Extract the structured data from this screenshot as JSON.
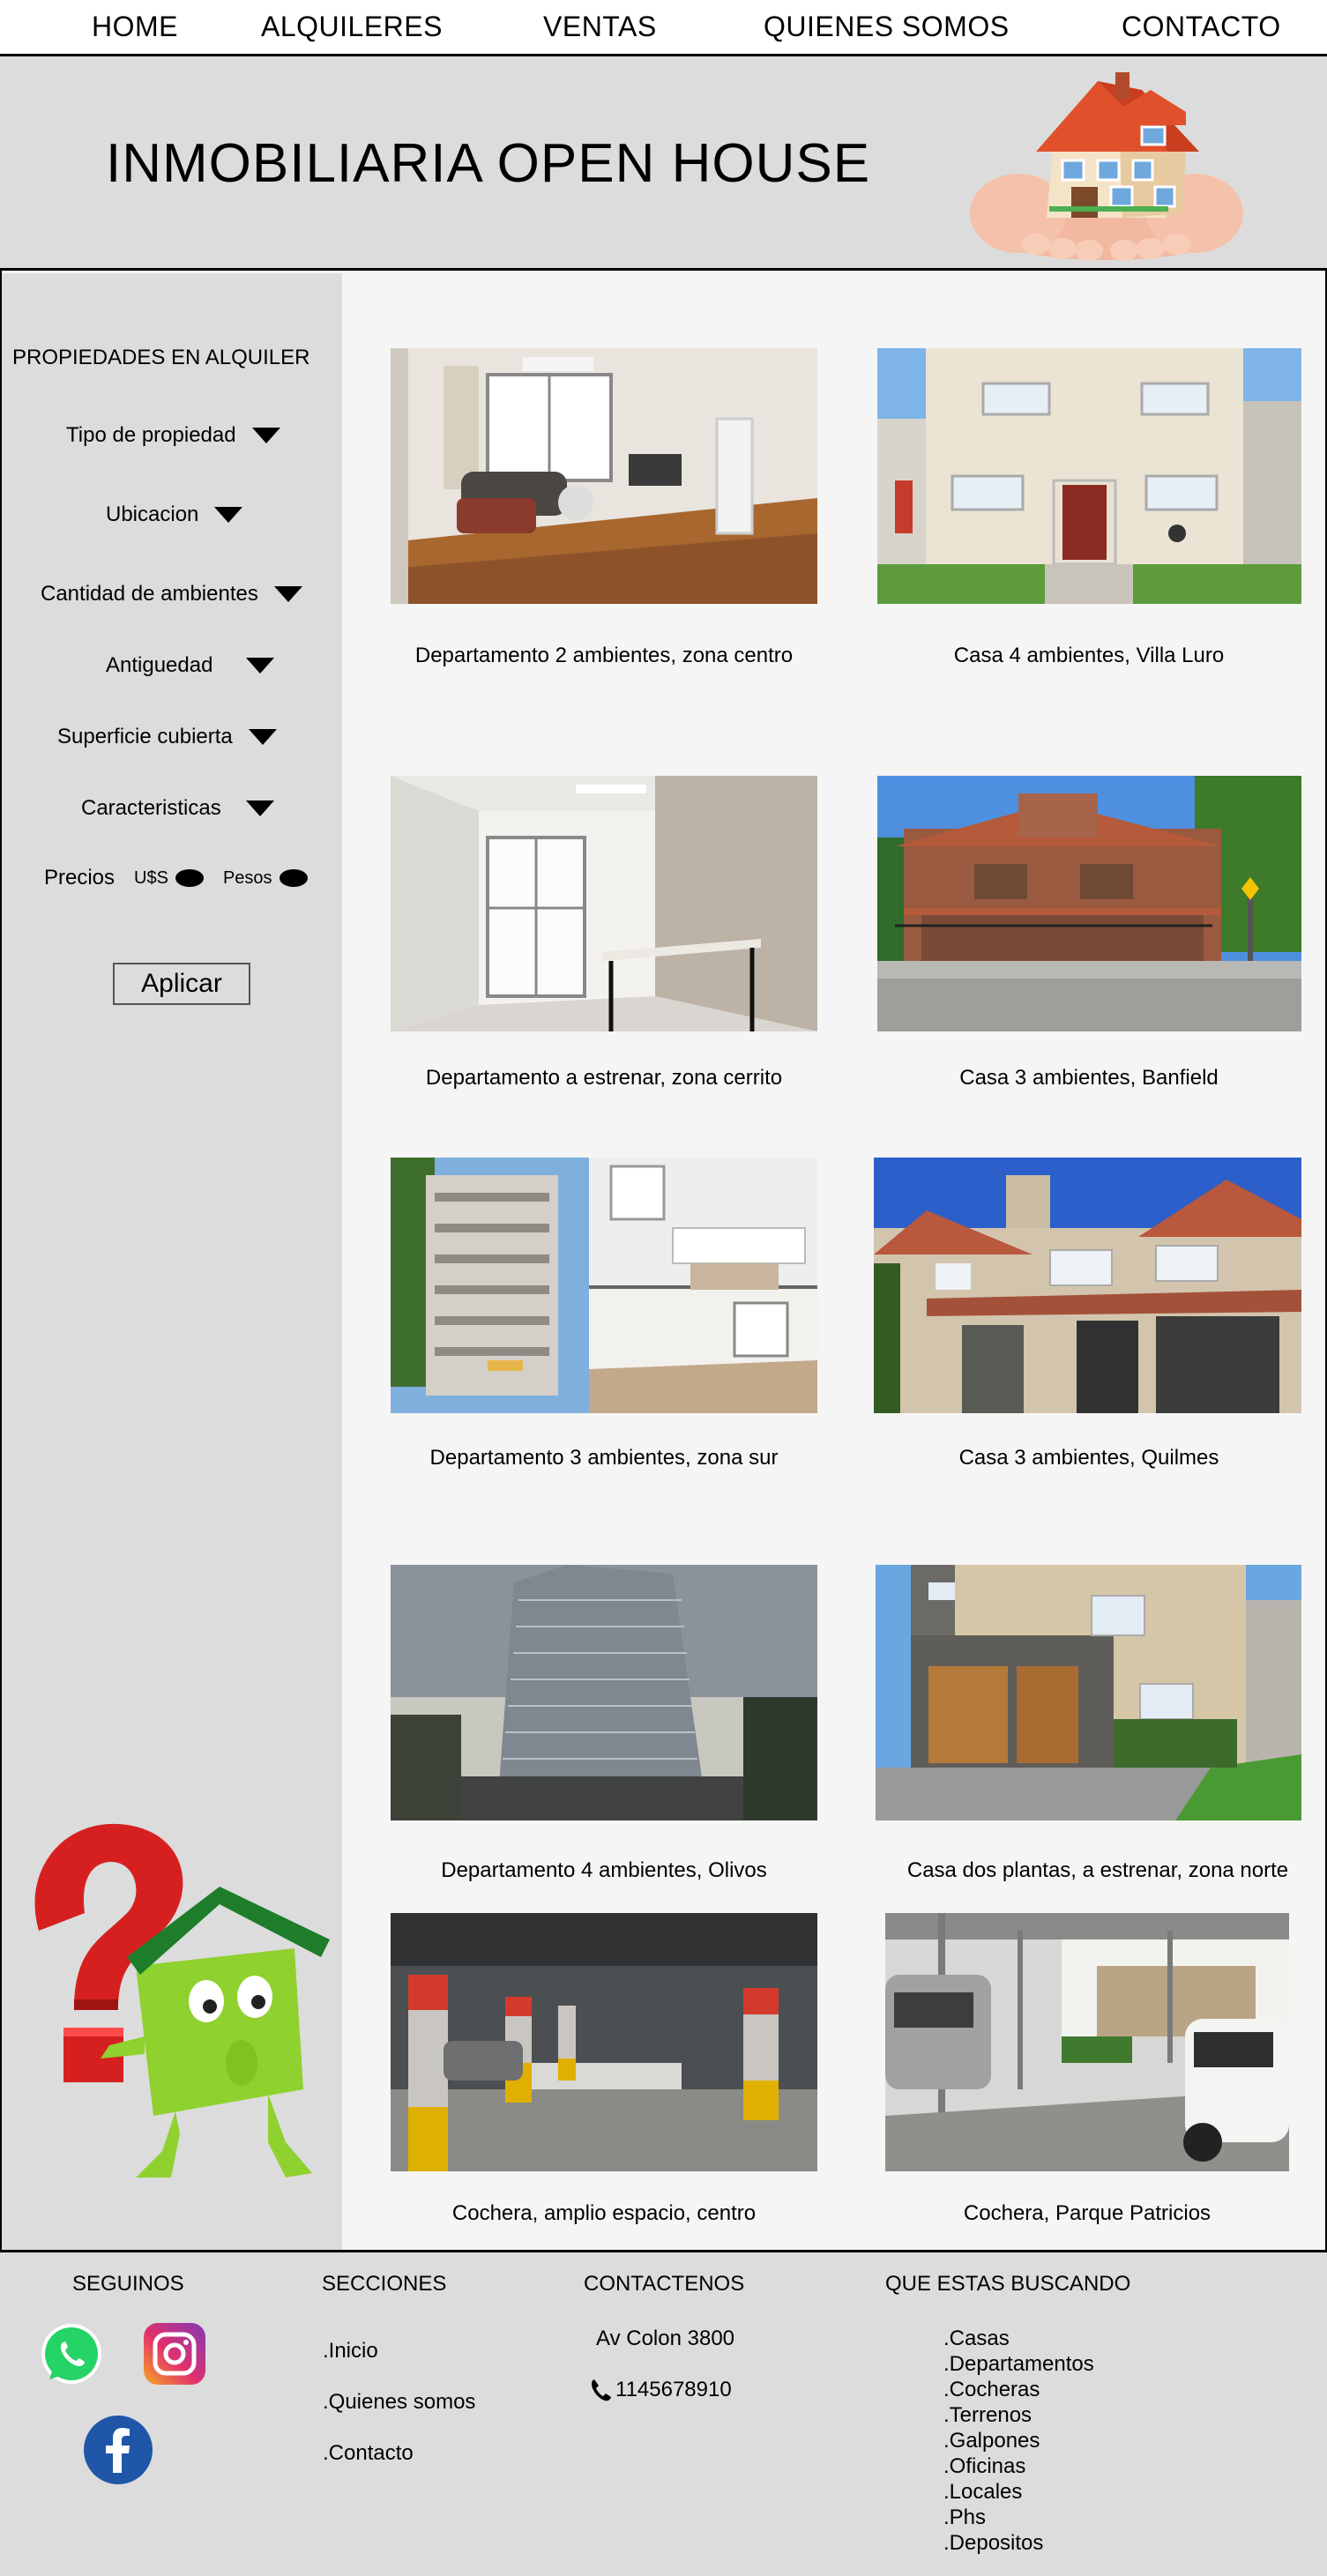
{
  "nav": {
    "home": "HOME",
    "alquileres": "ALQUILERES",
    "ventas": "VENTAS",
    "quienes": "QUIENES SOMOS",
    "contacto": "CONTACTO"
  },
  "header": {
    "title": "INMOBILIARIA OPEN HOUSE"
  },
  "sidebar": {
    "title": "PROPIEDADES EN ALQUILER",
    "filters": [
      "Tipo de propiedad",
      "Ubicacion",
      "Cantidad de ambientes",
      "Antiguedad",
      "Superficie cubierta",
      "Caracteristicas"
    ],
    "prices_label": "Precios",
    "currency_usd": "U$S",
    "currency_pesos": "Pesos",
    "apply_button": "Aplicar"
  },
  "listings": [
    {
      "caption": "Departamento 2 ambientes, zona centro",
      "icon": "apartment-living-room-photo"
    },
    {
      "caption": "Casa 4 ambientes, Villa Luro",
      "icon": "house-facade-photo"
    },
    {
      "caption": "Departamento a estrenar, zona cerrito",
      "icon": "empty-apartment-photo"
    },
    {
      "caption": "Casa 3 ambientes, Banfield",
      "icon": "brick-house-photo"
    },
    {
      "caption": "Departamento 3 ambientes, zona sur",
      "icon": "apartment-building-photo"
    },
    {
      "caption": "Casa 3 ambientes, Quilmes",
      "icon": "two-story-house-photo"
    },
    {
      "caption": "Departamento 4 ambientes, Olivos",
      "icon": "tower-photo"
    },
    {
      "caption": "Casa dos plantas, a estrenar, zona norte",
      "icon": "modern-house-photo"
    },
    {
      "caption": "Cochera, amplio espacio, centro",
      "icon": "parking-garage-photo"
    },
    {
      "caption": "Cochera, Parque Patricios",
      "icon": "carport-photo"
    }
  ],
  "footer": {
    "seguinos": "SEGUINOS",
    "secciones": "SECCIONES",
    "contactenos": "CONTACTENOS",
    "que_buscas": "QUE ESTAS BUSCANDO",
    "section_links": [
      ".Inicio",
      ".Quienes somos",
      ".Contacto"
    ],
    "address": "Av Colon 3800",
    "phone": "1145678910",
    "search_links": [
      ".Casas",
      ".Departamentos",
      ".Cocheras",
      ".Terrenos",
      ".Galpones",
      ".Oficinas",
      ".Locales",
      ".Phs",
      ".Depositos"
    ]
  },
  "colors": {
    "header_bg": "#dcdcdc",
    "content_bg": "#f5f5f5",
    "whatsapp": "#25d366",
    "facebook": "#1877f2"
  }
}
